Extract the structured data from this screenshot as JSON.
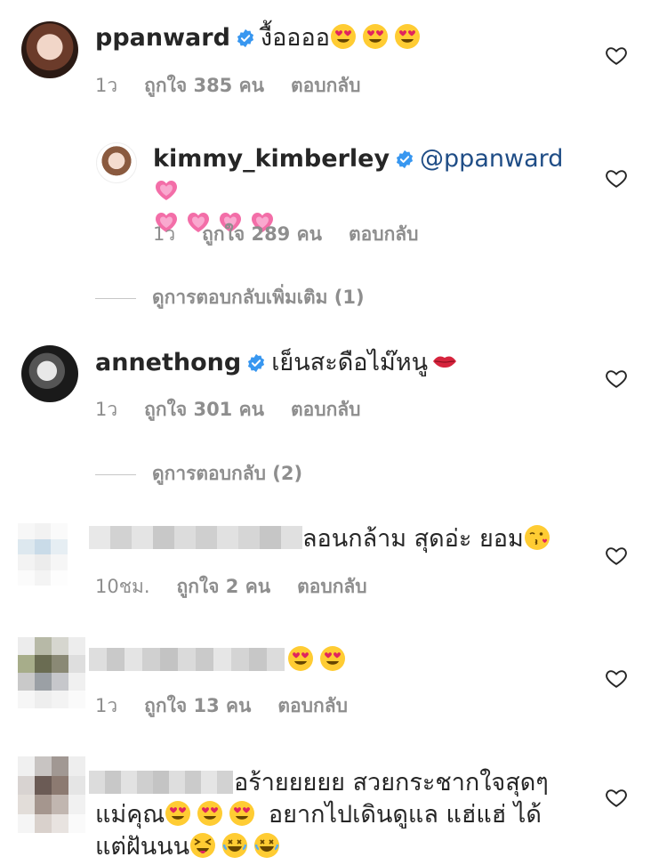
{
  "comments": [
    {
      "username": "ppanward",
      "verified": true,
      "text": "งื้ออออ",
      "time": "1ว",
      "likes": "ถูกใจ 385 คน",
      "reply": "ตอบกลับ"
    },
    {
      "username": "kimmy_kimberley",
      "verified": true,
      "mention": "@ppanward",
      "text": "",
      "time": "1ว",
      "likes": "ถูกใจ 289 คน",
      "reply": "ตอบกลับ"
    },
    {
      "view_more": "ดูการตอบกลับเพิ่มเติม (1)"
    },
    {
      "username": "annethong",
      "verified": true,
      "text": "เย็นสะดือไม๊หนู",
      "time": "1ว",
      "likes": "ถูกใจ 301 คน",
      "reply": "ตอบกลับ"
    },
    {
      "view_more": "ดูการตอบกลับ (2)"
    },
    {
      "username": "",
      "text": "ลอนกล้าม สุดอ่ะ ยอม",
      "time": "10ชม.",
      "likes": "ถูกใจ 2 คน",
      "reply": "ตอบกลับ"
    },
    {
      "username": "",
      "text": "",
      "time": "1ว",
      "likes": "ถูกใจ 13 คน",
      "reply": "ตอบกลับ"
    },
    {
      "username": "",
      "text_line1": "อร้ายยยยย สวยกระชากใจสุดๆ",
      "text_line2a": "แม่คุณ",
      "text_line2b": "อยากไปเดินดูแล แฮ่แฮ่ ได้",
      "text_line3": "แต่ฝันนน"
    }
  ],
  "icons": {
    "like": "heart-outline-icon",
    "verified": "verified-badge-icon",
    "heart_eyes": "heart-eyes-emoji",
    "pink_heart": "sparkling-heart-emoji",
    "kiss_lips": "kiss-mark-emoji",
    "kissing_wink": "face-blowing-kiss-emoji",
    "squint_tongue": "squinting-tongue-emoji",
    "rofl": "rolling-laughing-emoji"
  },
  "colors": {
    "text": "#262626",
    "meta": "#8e8e8e",
    "verified": "#3897f0",
    "mention": "#1f4d86"
  }
}
